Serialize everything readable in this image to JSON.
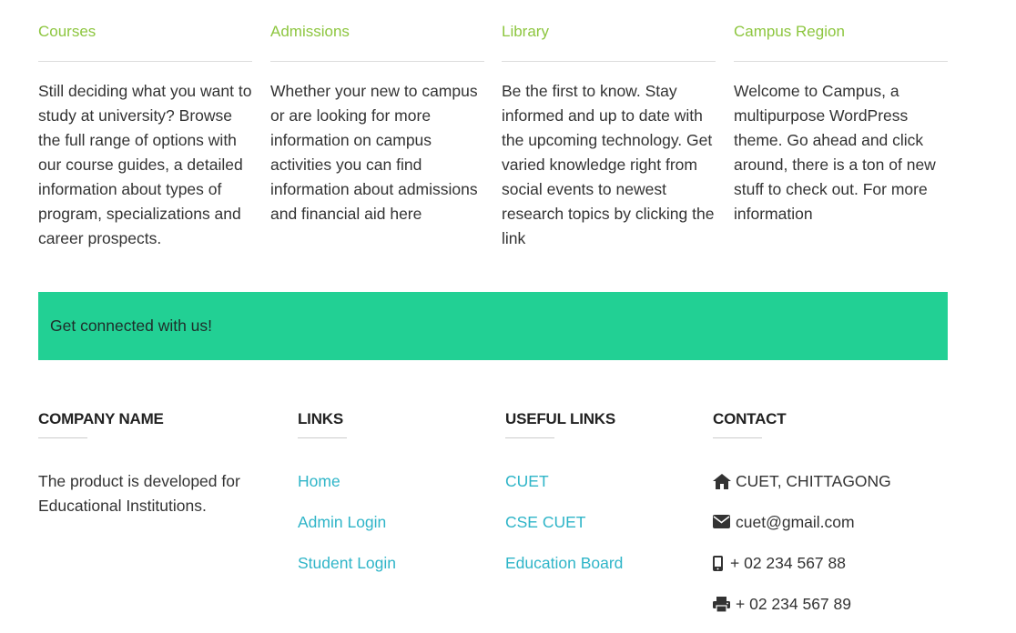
{
  "colors": {
    "accent_green": "#8dc63f",
    "banner_green": "#22d094",
    "link_teal": "#2fb5c8"
  },
  "features": [
    {
      "title": "Courses",
      "description": "Still deciding what you want to study at university? Browse the full range of options with our course guides, a detailed information about types of program, specializations and career prospects."
    },
    {
      "title": "Admissions",
      "description": "Whether your new to campus or are looking for more information on campus activities you can find information about admissions and financial aid here"
    },
    {
      "title": "Library",
      "description": "Be the first to know. Stay informed and up to date with the upcoming technology. Get varied knowledge right from social events to newest research topics by clicking the link"
    },
    {
      "title": "Campus Region",
      "description": "Welcome to Campus, a multipurpose WordPress theme. Go ahead and click around, there is a ton of new stuff to check out. For more information"
    }
  ],
  "banner": {
    "text": "Get connected with us!"
  },
  "footer": {
    "company": {
      "heading": "COMPANY NAME",
      "text": "The product is developed for Educational Institutions."
    },
    "links": {
      "heading": "LINKS",
      "items": [
        "Home",
        "Admin Login",
        "Student Login"
      ]
    },
    "useful_links": {
      "heading": "USEFUL LINKS",
      "items": [
        "CUET",
        "CSE CUET",
        "Education Board"
      ]
    },
    "contact": {
      "heading": "CONTACT",
      "items": [
        {
          "icon": "home-icon",
          "text": "CUET, CHITTAGONG"
        },
        {
          "icon": "envelope-icon",
          "text": "cuet@gmail.com"
        },
        {
          "icon": "mobile-phone-icon",
          "text": "+ 02 234 567 88"
        },
        {
          "icon": "printer-icon",
          "text": "+ 02 234 567 89"
        }
      ]
    }
  }
}
